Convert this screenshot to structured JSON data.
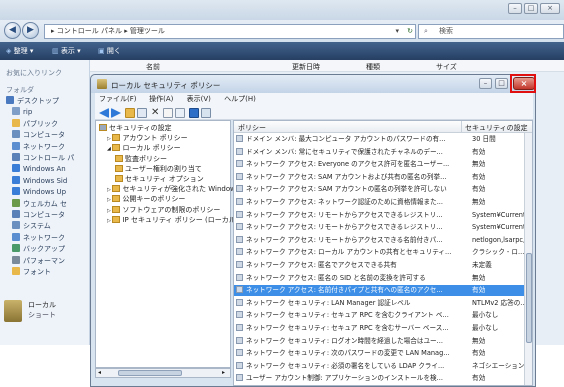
{
  "outer": {
    "breadcrumb": "▸ コントロール パネル ▸ 管理ツール",
    "search_placeholder": "検索",
    "toolbar": {
      "organize": "整理 ▾",
      "views": "表示 ▾",
      "open": "開く"
    },
    "column_headers": {
      "name": "名前",
      "date": "更新日時",
      "type": "種類",
      "size": "サイズ"
    },
    "left_pane": {
      "favorites": "お気に入りリンク",
      "folders": "フォルダ",
      "items": [
        "デスクトップ",
        "rip",
        "パブリック",
        "コンピュータ",
        "ネットワーク",
        "コントロール パ",
        "Windows An",
        "Windows Sid",
        "Windows Up",
        "ウェルカム セ",
        "コンピュータ",
        "システム",
        "ネットワーク",
        "バックアップ",
        "パフォーマン",
        "フォント"
      ]
    },
    "details": {
      "name": "ローカル",
      "sub": "ショート"
    }
  },
  "dialog": {
    "title": "ローカル セキュリティ ポリシー",
    "menu": [
      "ファイル(F)",
      "操作(A)",
      "表示(V)",
      "ヘルプ(H)"
    ],
    "tree": [
      {
        "label": "セキュリティの設定",
        "level": 0
      },
      {
        "label": "アカウント ポリシー",
        "level": 1
      },
      {
        "label": "ローカル ポリシー",
        "level": 1
      },
      {
        "label": "監査ポリシー",
        "level": 2
      },
      {
        "label": "ユーザー権利の割り当て",
        "level": 2
      },
      {
        "label": "セキュリティ オプション",
        "level": 2
      },
      {
        "label": "セキュリティが強化された Windows",
        "level": 1
      },
      {
        "label": "公開キーのポリシー",
        "level": 1
      },
      {
        "label": "ソフトウェアの制限のポリシー",
        "level": 1
      },
      {
        "label": "IP セキュリティ ポリシー (ローカル",
        "level": 1
      }
    ],
    "list_headers": {
      "policy": "ポリシー",
      "setting": "セキュリティの設定"
    },
    "rows": [
      {
        "p": "ドメイン メンバ: 最大コンピュータ アカウントのパスワードの有...",
        "s": "30 日間"
      },
      {
        "p": "ドメイン メンバ: 常にセキュリティで保護されたチャネルのデー...",
        "s": "有効"
      },
      {
        "p": "ネットワーク アクセス: Everyone のアクセス許可を匿名ユーザー...",
        "s": "無効"
      },
      {
        "p": "ネットワーク アクセス: SAM アカウントおよび共有の匿名の列挙...",
        "s": "有効"
      },
      {
        "p": "ネットワーク アクセス: SAM アカウントの匿名の列挙を許可しない",
        "s": "有効"
      },
      {
        "p": "ネットワーク アクセス: ネットワーク認証のために資格情報また...",
        "s": "無効"
      },
      {
        "p": "ネットワーク アクセス: リモートからアクセスできるレジストリ...",
        "s": "System¥Current..."
      },
      {
        "p": "ネットワーク アクセス: リモートからアクセスできるレジストリ...",
        "s": "System¥Current..."
      },
      {
        "p": "ネットワーク アクセス: リモートからアクセスできる名前付きパ...",
        "s": "netlogon,lsarpc,..."
      },
      {
        "p": "ネットワーク アクセス: ローカル アカウントの共有とセキュリティ...",
        "s": "クラシック - ロ..."
      },
      {
        "p": "ネットワーク アクセス: 匿名でアクセスできる共有",
        "s": "未定義"
      },
      {
        "p": "ネットワーク アクセス: 匿名の SID と名前の変換を許可する",
        "s": "無効"
      },
      {
        "p": "ネットワーク アクセス: 名前付きパイプと共有への匿名のアクセ...",
        "s": "有効",
        "selected": true
      },
      {
        "p": "ネットワーク セキュリティ: LAN Manager 認証レベル",
        "s": "NTLMv2 応答の..."
      },
      {
        "p": "ネットワーク セキュリティ: セキュア RPC を含むクライアント ベ...",
        "s": "最小なし"
      },
      {
        "p": "ネットワーク セキュリティ: セキュア RPC を含むサーバー ベース...",
        "s": "最小なし"
      },
      {
        "p": "ネットワーク セキュリティ: ログオン時間を経過した場合はユー...",
        "s": "無効"
      },
      {
        "p": "ネットワーク セキュリティ: 次のパスワードの変更で LAN Manag...",
        "s": "有効"
      },
      {
        "p": "ネットワーク セキュリティ: 必須の署名をしている LDAP クライ...",
        "s": "ネゴシエーション..."
      },
      {
        "p": "ユーザー アカウント制御: アプリケーションのインストールを検...",
        "s": "有効"
      }
    ]
  },
  "colors": {
    "selection": "#3d8ee6",
    "toolbar": "#263f63",
    "highlight_box": "#e01010"
  }
}
